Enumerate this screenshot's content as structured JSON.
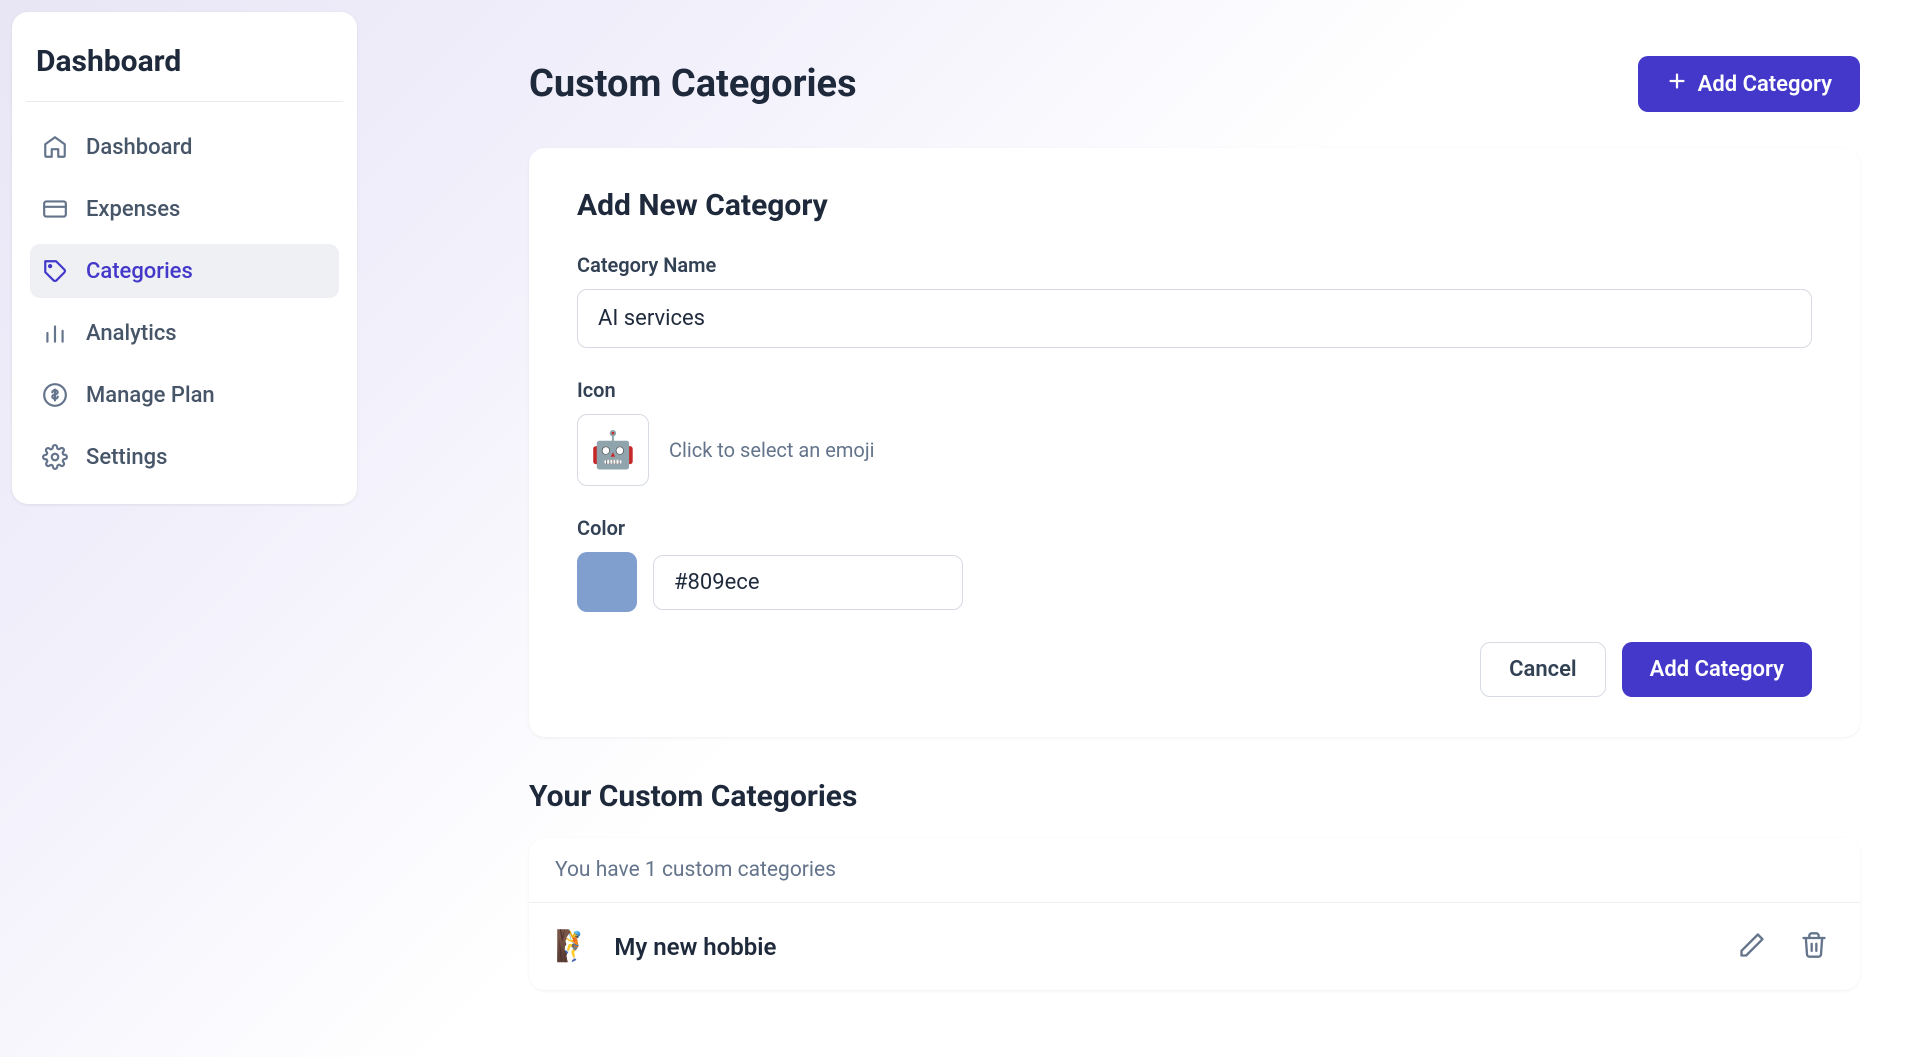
{
  "sidebar": {
    "title": "Dashboard",
    "items": [
      {
        "label": "Dashboard"
      },
      {
        "label": "Expenses"
      },
      {
        "label": "Categories"
      },
      {
        "label": "Analytics"
      },
      {
        "label": "Manage Plan"
      },
      {
        "label": "Settings"
      }
    ]
  },
  "header": {
    "title": "Custom Categories",
    "add_button": "Add Category"
  },
  "form": {
    "title": "Add New Category",
    "name_label": "Category Name",
    "name_value": "AI services",
    "icon_label": "Icon",
    "icon_emoji": "🤖",
    "icon_hint": "Click to select an emoji",
    "color_label": "Color",
    "color_value": "#809ece",
    "cancel_label": "Cancel",
    "submit_label": "Add Category"
  },
  "categories_section": {
    "title": "Your Custom Categories",
    "count_text": "You have 1 custom categories",
    "items": [
      {
        "icon": "🧗",
        "name": "My new hobbie"
      }
    ]
  },
  "colors": {
    "primary": "#4338ca",
    "swatch": "#809ece"
  }
}
